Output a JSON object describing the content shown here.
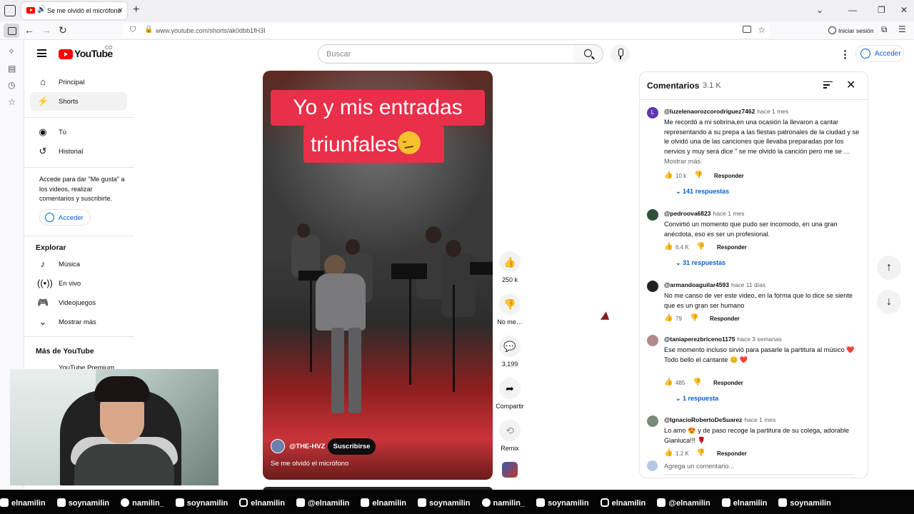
{
  "browser": {
    "tab_title": "Se me olvidó el micrófono",
    "url": "www.youtube.com/shorts/ak0dbb1fH3I",
    "signin_label": "Iniciar sesión"
  },
  "youtube": {
    "logo_text": "YouTube",
    "country_code": "CO",
    "search_placeholder": "Buscar",
    "sign_in": "Acceder"
  },
  "guide": {
    "primary": [
      {
        "label": "Principal",
        "icon": "home-icon"
      },
      {
        "label": "Shorts",
        "icon": "shorts-icon",
        "active": true
      }
    ],
    "you": [
      {
        "label": "Tú",
        "icon": "account-icon"
      },
      {
        "label": "Historial",
        "icon": "history-icon"
      }
    ],
    "promo_text": "Accede para dar \"Me gusta\" a los videos, realizar comentarios y suscribirte.",
    "promo_button": "Acceder",
    "explore_heading": "Explorar",
    "explore": [
      {
        "label": "Música",
        "icon": "music-icon"
      },
      {
        "label": "En vivo",
        "icon": "live-icon"
      },
      {
        "label": "Videojuegos",
        "icon": "gaming-icon"
      },
      {
        "label": "Mostrar más",
        "icon": "chevron-down-icon"
      }
    ],
    "more_heading": "Más de YouTube",
    "more": [
      {
        "label": "YouTube Premium",
        "icon": "youtube-premium-icon"
      }
    ]
  },
  "short": {
    "caption_line1": "Yo y mis entradas",
    "caption_line2": "triunfales",
    "channel": "@THE-HVZ",
    "subscribe": "Suscribirse",
    "title": "Se me olvidó el micrófono",
    "actions": {
      "like_count": "250 k",
      "dislike_label": "No me…",
      "comment_count": "3,199",
      "share_label": "Compartir",
      "remix_label": "Remix"
    }
  },
  "comments": {
    "heading": "Comentarios",
    "count": "3.1 K",
    "reply_label": "Responder",
    "more_label": "Mostrar más",
    "add_placeholder": "Agrega un comentario...",
    "items": [
      {
        "author": "@luzelenaorozcorodriguez7462",
        "time": "hace 1 mes",
        "avatar_letter": "L",
        "avatar_color": "#5e35b1",
        "text": "Me recordó a mi sobrina,en una ocasión la llevaron a cantar representando a su prepa a las fiestas patronales de la ciudad y se le olvidó una de las canciones que llevaba preparadas por los nervios y muy será dice \" se me olvidó la canción pero me se …",
        "likes": "10 k",
        "replies": "141 respuestas"
      },
      {
        "author": "@pedroova6823",
        "time": "hace 1 mes",
        "avatar_color": "#2f4f3a",
        "text": "Convirtió un momento que pudo ser incomodo, en una gran anécdota, eso es ser un profesional.",
        "likes": "6.4 K",
        "replies": "31 respuestas"
      },
      {
        "author": "@armandoaguilar4593",
        "time": "hace 11 días",
        "avatar_color": "#222222",
        "text": "No me canso de ver este video, en la forma que lo dice se siente que es un gran ser humano",
        "likes": "79"
      },
      {
        "author": "@taniaperezbriceno1175",
        "time": "hace 3 semanas",
        "avatar_color": "#b08a8a",
        "text_line1": "Ese momento incluso sirvió para pasarle la partitura al músico ❤️",
        "text_line2": "Todo bello el cantante 😊 ❤️",
        "likes": "485",
        "replies": "1 respuesta"
      },
      {
        "author": "@IgnacioRobertoDeSuarez",
        "time": "hace 1 mes",
        "avatar_color": "#7a8a7a",
        "text": "Lo amo 😍 y de paso recoge la partitura de su colega, adorable Gianluca!!! 🌹",
        "likes": "1.2 K"
      }
    ]
  },
  "social_bar": [
    {
      "icon": "discord-icon",
      "handle": "elnamilin"
    },
    {
      "icon": "tiktok-icon",
      "handle": "soynamilin"
    },
    {
      "icon": "x-icon",
      "handle": "namilin_"
    },
    {
      "icon": "facebook-icon",
      "handle": "soynamilin"
    },
    {
      "icon": "instagram-icon",
      "handle": "elnamilin"
    },
    {
      "icon": "twitch-icon",
      "handle": "@elnamilin"
    },
    {
      "icon": "discord-icon",
      "handle": "elnamilin"
    },
    {
      "icon": "tiktok-icon",
      "handle": "soynamilin"
    },
    {
      "icon": "x-icon",
      "handle": "namilin_"
    },
    {
      "icon": "facebook-icon",
      "handle": "soynamilin"
    },
    {
      "icon": "instagram-icon",
      "handle": "elnamilin"
    },
    {
      "icon": "twitch-icon",
      "handle": "@elnamilin"
    },
    {
      "icon": "discord-icon",
      "handle": "elnamilin"
    },
    {
      "icon": "tiktok-icon",
      "handle": "soynamilin"
    }
  ],
  "colors": {
    "youtube_red": "#ff0000",
    "link_blue": "#065fd4",
    "caption_red": "#ea2f4a"
  }
}
